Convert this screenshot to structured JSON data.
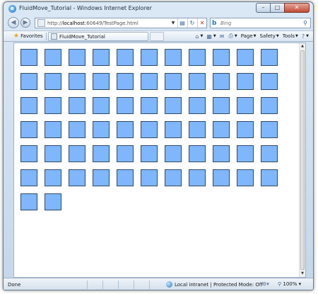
{
  "window": {
    "title": "FluidMove_Tutorial - Windows Internet Explorer",
    "buttons": {
      "minimize": "–",
      "maximize": "□",
      "close": "✕"
    }
  },
  "address_bar": {
    "prefix": "http://",
    "host": "localhost",
    "path": ":60649/TestPage.html",
    "search_placeholder": "Bing"
  },
  "favorites_bar": {
    "favorites_label": "Favorites",
    "tab_title": "FluidMove_Tutorial"
  },
  "command_bar": {
    "items": [
      {
        "label": "Page"
      },
      {
        "label": "Safety"
      },
      {
        "label": "Tools"
      }
    ]
  },
  "content": {
    "tile_count": 68,
    "tiles_per_row": 11,
    "tile_color": "#80b6fc",
    "tile_border_color": "#2e4a6b"
  },
  "status_bar": {
    "status": "Done",
    "zone": "Local intranet | Protected Mode: Off",
    "zoom": "100%"
  },
  "colors": {
    "frame": "#c4d7ea",
    "page_background": "#ffffff"
  }
}
